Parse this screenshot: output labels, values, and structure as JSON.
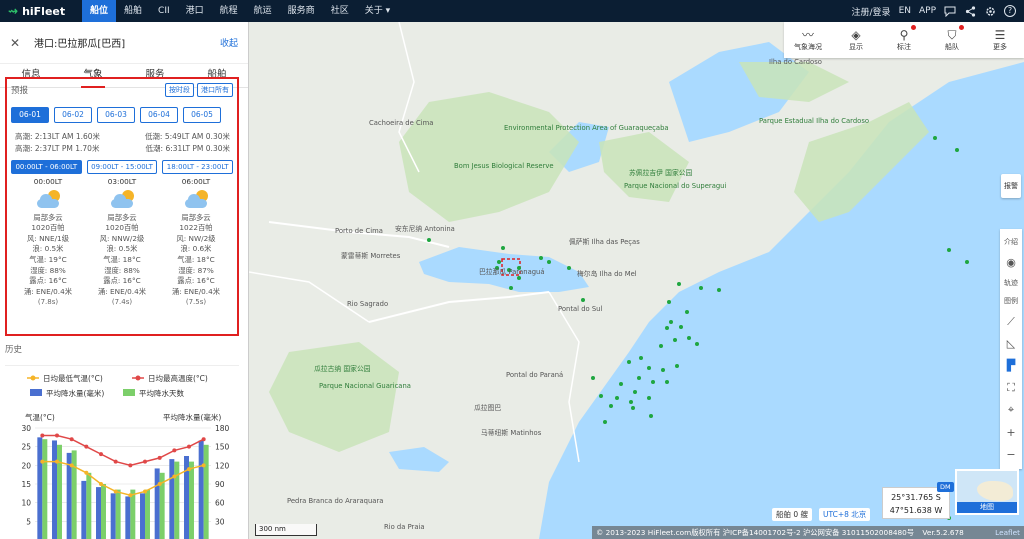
{
  "app": {
    "brand": "hiFleet",
    "nav": [
      "船位",
      "船舶",
      "CII",
      "港口",
      "航程",
      "航运",
      "服务商",
      "社区",
      "关于"
    ],
    "active_nav": "船位",
    "about_chevron": "chevron-down-icon",
    "top_right": {
      "login": "注册/登录",
      "lang": "EN",
      "app": "APP",
      "icons": [
        "chat-icon",
        "share-icon",
        "settings-icon",
        "help-icon"
      ],
      "help_glyph": "?"
    }
  },
  "panel": {
    "title": "港口:巴拉那瓜[巴西]",
    "collapse": "收起",
    "tabs": [
      "信息",
      "气象",
      "服务",
      "船舶"
    ],
    "active_tab": "气象",
    "forecast": {
      "label": "预报",
      "btn1": "按时段",
      "btn2": "港口所有",
      "dates": [
        "06-01",
        "06-02",
        "06-03",
        "06-04",
        "06-05"
      ],
      "active_date": "06-01",
      "tides": [
        [
          "高潮: 2:13LT AM 1.60米",
          "低潮: 5:49LT AM 0.30米"
        ],
        [
          "高潮: 2:37LT PM 1.70米",
          "低潮: 6:31LT PM 0.30米"
        ]
      ],
      "slots": [
        "00:00LT - 06:00LT",
        "09:00LT - 15:00LT",
        "18:00LT - 23:00LT"
      ],
      "active_slot": "00:00LT - 06:00LT",
      "columns": [
        {
          "time": "00:00LT",
          "desc": "局部多云",
          "pressure": "1020百帕",
          "wind": "风: NNE/1级",
          "wave": "浪: 0.5米",
          "temp": "气温: 19°C",
          "humidity": "湿度: 88%",
          "dew": "露点: 16°C",
          "swell": "涌: ENE/0.4米",
          "period": "(7.8s)"
        },
        {
          "time": "03:00LT",
          "desc": "局部多云",
          "pressure": "1020百帕",
          "wind": "风: NNW/2级",
          "wave": "浪: 0.5米",
          "temp": "气温: 18°C",
          "humidity": "湿度: 88%",
          "dew": "露点: 16°C",
          "swell": "涌: ENE/0.4米",
          "period": "(7.4s)"
        },
        {
          "time": "06:00LT",
          "desc": "局部多云",
          "pressure": "1022百帕",
          "wind": "风: NW/2级",
          "wave": "浪: 0.6米",
          "temp": "气温: 18°C",
          "humidity": "湿度: 87%",
          "dew": "露点: 16°C",
          "swell": "涌: ENE/0.4米",
          "period": "(7.5s)"
        }
      ]
    },
    "history": {
      "label": "历史"
    }
  },
  "chart_data": {
    "type": "bar",
    "legend": [
      "日均最低气温(°C)",
      "日均最高温度(°C)",
      "平均降水量(毫米)",
      "平均降水天数"
    ],
    "colors": {
      "min_temp": "#f5b428",
      "max_temp": "#e04848",
      "precip": "#4a6fd0",
      "rain_days": "#7ccf6a"
    },
    "ylabel_left": "气温(°C)",
    "ylabel_right": "平均降水量(毫米)",
    "ylim_left": [
      0,
      30
    ],
    "yticks_left": [
      30,
      25,
      20,
      15,
      10,
      5
    ],
    "ylim_right": [
      0,
      180
    ],
    "yticks_right": [
      180,
      150,
      120,
      90,
      60,
      30
    ],
    "months": 12,
    "precip": [
      165,
      160,
      140,
      95,
      85,
      75,
      70,
      75,
      115,
      130,
      135,
      160
    ],
    "rain_days": [
      18,
      17,
      16,
      12,
      10,
      9,
      9,
      9,
      12,
      14,
      14,
      17
    ],
    "max_temp": [
      28,
      28,
      27,
      25,
      23,
      21,
      20,
      21,
      22,
      24,
      25,
      27
    ],
    "min_temp": [
      21,
      21,
      20,
      18,
      15,
      13,
      12,
      13,
      15,
      17,
      19,
      20
    ]
  },
  "map": {
    "toolbar": [
      {
        "label": "气象海况",
        "icon": "weather-icon",
        "dot": false
      },
      {
        "label": "显示",
        "icon": "layers-icon",
        "dot": false
      },
      {
        "label": "标注",
        "icon": "marker-icon",
        "dot": true
      },
      {
        "label": "船队",
        "icon": "fleet-icon",
        "dot": true
      },
      {
        "label": "更多",
        "icon": "menu-icon",
        "dot": false
      }
    ],
    "report_btn": "报警",
    "right_tools": [
      {
        "label": "介绍",
        "icon": "intro-icon"
      },
      {
        "label": "",
        "icon": "eye-icon"
      },
      {
        "label": "轨迹",
        "icon": "track-icon"
      },
      {
        "label": "图例",
        "icon": "legend-icon"
      },
      {
        "label": "",
        "icon": "ruler-icon"
      },
      {
        "label": "",
        "icon": "angle-icon"
      },
      {
        "label": "",
        "icon": "flag-icon"
      },
      {
        "label": "",
        "icon": "fullscreen-icon"
      },
      {
        "label": "",
        "icon": "locate-icon"
      },
      {
        "label": "",
        "icon": "zoom-in-icon"
      },
      {
        "label": "",
        "icon": "zoom-out-icon"
      }
    ],
    "scale": "300 nm",
    "ship_count": "船舶 0 艘",
    "utc": "UTC+8 北京",
    "coord": {
      "lat": "25°31.765 S",
      "lon": "47°51.638 W",
      "mode": "DM"
    },
    "minimap_label": "地图",
    "copyright": "© 2013-2023 HiFleet.com版权所有 沪ICP备14001702号-2 沪公网安备 31011502008480号",
    "version": "Ver.5.2.678",
    "leaflet": "Leaflet",
    "labels": [
      "Ilha do Cardoso",
      "Parque Estadual Ilha do Cardoso",
      "Environmental Protection Area of Guaraqueçaba",
      "Cachoeira de Cima",
      "Bom Jesus Biological Reserve",
      "苏佩拉吉伊 国家公园",
      "Parque Nacional do Superagui",
      "安东尼纳 Antonina",
      "Porto de Cima",
      "蒙雷蒂斯 Morretes",
      "巴拉那瓜 Paranaguá",
      "梅尔岛 Ilha do Mel",
      "佩萨斯 Ilha das Peças",
      "Pontal do Sul",
      "Pontal do Paraná",
      "Rio Sagrado",
      "瓜拉图巴",
      "马蒂纽斯 Matinhos",
      "瓜拉古纳 国家公园",
      "Parque Nacional Guaricana",
      "Pedra Branca do Araraquara",
      "Rio da Praia"
    ]
  }
}
